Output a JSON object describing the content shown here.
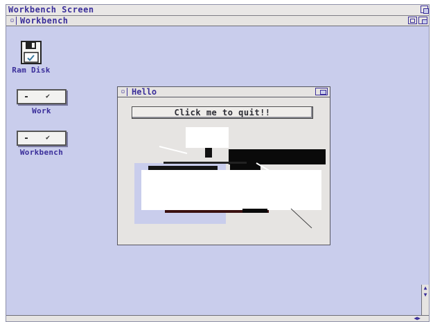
{
  "screen": {
    "title": "Workbench Screen"
  },
  "workbench_window": {
    "title": "Workbench",
    "close_glyph": "▫"
  },
  "icons": [
    {
      "label": "Ram Disk",
      "icon": "floppy-disk-icon"
    },
    {
      "label": "Work",
      "icon": "hard-drive-icon"
    },
    {
      "label": "Workbench",
      "icon": "hard-drive-icon"
    }
  ],
  "hello_window": {
    "title": "Hello",
    "close_glyph": "▫",
    "button_label": "Click me to quit!!"
  },
  "scroll": {
    "up": "▲",
    "down": "▼",
    "left": "◀",
    "right": "▶"
  },
  "colors": {
    "screen_bg": "#c9cdec",
    "title_text": "#3a2e9a",
    "chrome": "#e6e4e2"
  }
}
